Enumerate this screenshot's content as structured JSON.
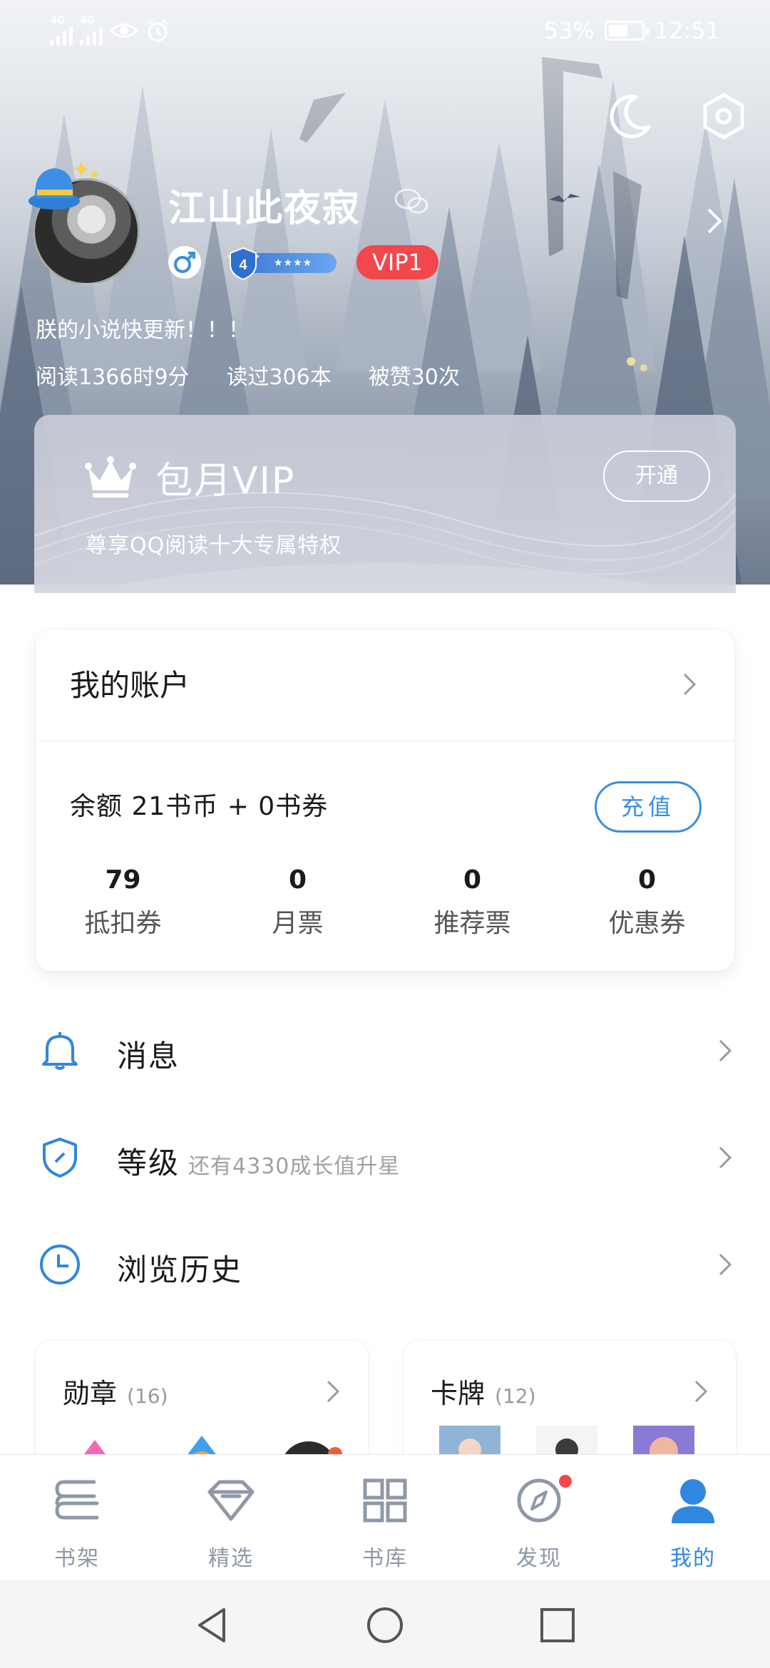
{
  "status_bar": {
    "signal1_label": "4G",
    "signal2_label": "4G",
    "battery_percent": "53%",
    "time": "12:51"
  },
  "profile": {
    "username": "江山此夜寂",
    "level": "4",
    "level_stars": "★★★★",
    "vip_badge": "VIP1",
    "signature": "朕的小说快更新！！！",
    "stats": [
      "阅读1366时9分",
      "读过306本",
      "被赞30次"
    ]
  },
  "vip_card": {
    "title": "包月VIP",
    "description": "尊享QQ阅读十大专属特权",
    "open_button": "开通"
  },
  "account": {
    "title": "我的账户",
    "balance": "余额   21书币 + 0书券",
    "recharge_button": "充值",
    "items": [
      {
        "value": "79",
        "label": "抵扣券"
      },
      {
        "value": "0",
        "label": "月票"
      },
      {
        "value": "0",
        "label": "推荐票"
      },
      {
        "value": "0",
        "label": "优惠券"
      }
    ]
  },
  "menu": {
    "messages": {
      "label": "消息",
      "icon": "bell-icon"
    },
    "level": {
      "label": "等级",
      "sub": "还有4330成长值升星",
      "icon": "shield-icon"
    },
    "history": {
      "label": "浏览历史",
      "icon": "clock-icon"
    }
  },
  "medals": {
    "title": "勋章",
    "count": "(16)"
  },
  "cards": {
    "title": "卡牌",
    "count": "(12)"
  },
  "bottom_nav": [
    {
      "label": "书架",
      "icon": "bookshelf-icon",
      "active": false
    },
    {
      "label": "精选",
      "icon": "diamond-icon",
      "active": false
    },
    {
      "label": "书库",
      "icon": "grid-icon",
      "active": false
    },
    {
      "label": "发现",
      "icon": "compass-icon",
      "active": false,
      "badge": true
    },
    {
      "label": "我的",
      "icon": "person-icon",
      "active": true
    }
  ],
  "colors": {
    "accent_blue": "#2f87e0",
    "vip_red": "#f2474d",
    "nav_inactive": "#8e98a6"
  }
}
